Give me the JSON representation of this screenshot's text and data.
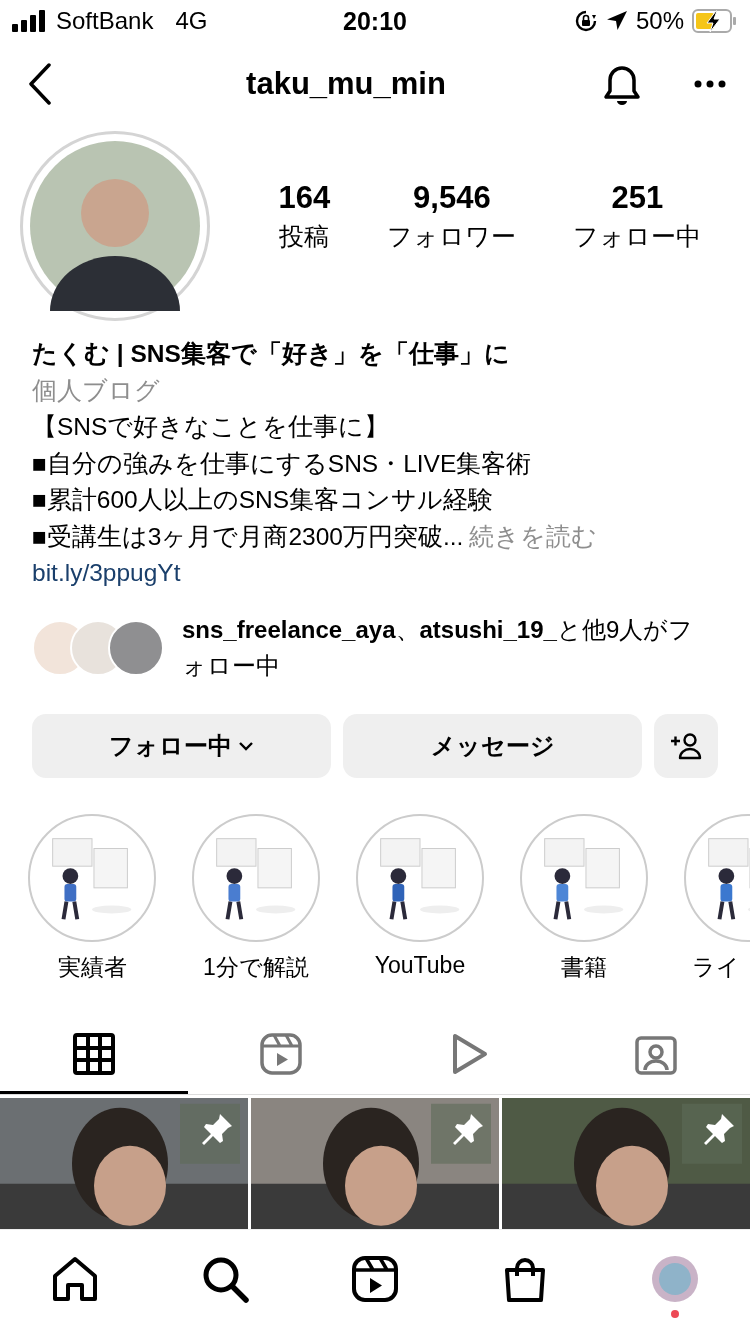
{
  "status_bar": {
    "carrier": "SoftBank",
    "network": "4G",
    "time": "20:10",
    "battery": "50%"
  },
  "header": {
    "username": "taku_mu_min"
  },
  "stats": [
    {
      "value": "164",
      "label": "投稿"
    },
    {
      "value": "9,546",
      "label": "フォロワー"
    },
    {
      "value": "251",
      "label": "フォロー中"
    }
  ],
  "bio": {
    "name": "たくむ | SNS集客で「好き」を「仕事」に",
    "category": "個人ブログ",
    "lines": [
      "【SNSで好きなことを仕事に】",
      "■自分の強みを仕事にするSNS・LIVE集客術",
      "■累計600人以上のSNS集客コンサル経験",
      "■受講生は3ヶ月で月商2300万円突破..."
    ],
    "more": "続きを読む",
    "link": "bit.ly/3ppugYt"
  },
  "followed_by": {
    "text": "**sns_freelance_aya**、**atsushi_19_**と他9人がフォロー中"
  },
  "actions": {
    "following": "フォロー中",
    "message": "メッセージ"
  },
  "highlights": [
    {
      "label": "実績者"
    },
    {
      "label": "1分で解説"
    },
    {
      "label": "YouTube"
    },
    {
      "label": "書籍"
    },
    {
      "label": "ライ"
    }
  ],
  "tabs": [
    {
      "kind": "grid",
      "selected": true
    },
    {
      "kind": "reels",
      "selected": false
    },
    {
      "kind": "video",
      "selected": false
    },
    {
      "kind": "tagged",
      "selected": false
    }
  ],
  "posts": [
    {
      "pinned": true
    },
    {
      "pinned": true
    },
    {
      "pinned": true
    }
  ],
  "bottom_nav": [
    {
      "kind": "home",
      "badge": false
    },
    {
      "kind": "search",
      "badge": false
    },
    {
      "kind": "reels",
      "badge": false
    },
    {
      "kind": "shop",
      "badge": false
    },
    {
      "kind": "profile",
      "badge": true
    }
  ]
}
